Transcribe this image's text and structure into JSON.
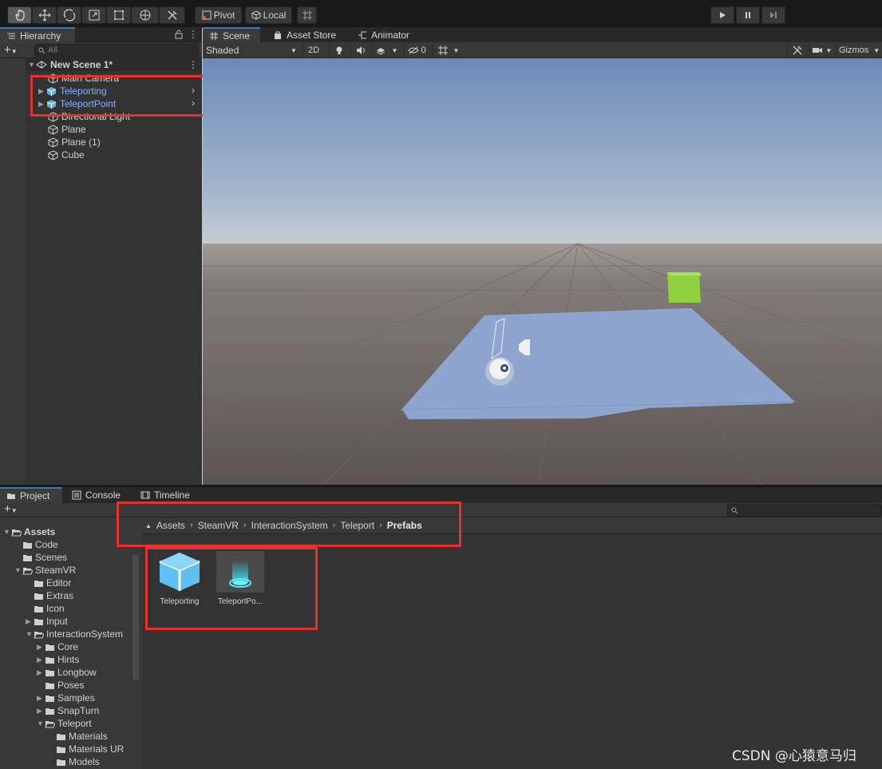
{
  "toolbar": {
    "pivot_label": "Pivot",
    "local_label": "Local"
  },
  "hierarchy": {
    "tab_label": "Hierarchy",
    "search_placeholder": "All",
    "scene_name": "New Scene 1*",
    "items": [
      {
        "label": "Main Camera",
        "prefab": false
      },
      {
        "label": "Teleporting",
        "prefab": true
      },
      {
        "label": "TeleportPoint",
        "prefab": true
      },
      {
        "label": "Directional Light",
        "prefab": false
      },
      {
        "label": "Plane",
        "prefab": false
      },
      {
        "label": "Plane (1)",
        "prefab": false
      },
      {
        "label": "Cube",
        "prefab": false
      }
    ]
  },
  "scene_tabs": {
    "scene": "Scene",
    "asset_store": "Asset Store",
    "animator": "Animator"
  },
  "scene_toolbar": {
    "shading_mode": "Shaded",
    "mode_2d": "2D",
    "hidden_count": "0",
    "gizmos": "Gizmos"
  },
  "bottom_tabs": {
    "project": "Project",
    "console": "Console",
    "timeline": "Timeline"
  },
  "breadcrumb": [
    "Assets",
    "SteamVR",
    "InteractionSystem",
    "Teleport",
    "Prefabs"
  ],
  "project_tree": [
    {
      "label": "Assets",
      "level": 0,
      "expanded": true,
      "bold": true
    },
    {
      "label": "Code",
      "level": 1
    },
    {
      "label": "Scenes",
      "level": 1
    },
    {
      "label": "SteamVR",
      "level": 1,
      "expanded": true
    },
    {
      "label": "Editor",
      "level": 2
    },
    {
      "label": "Extras",
      "level": 2
    },
    {
      "label": "Icon",
      "level": 2
    },
    {
      "label": "Input",
      "level": 2,
      "collapsed": true
    },
    {
      "label": "InteractionSystem",
      "level": 2,
      "expanded": true
    },
    {
      "label": "Core",
      "level": 3,
      "collapsed": true
    },
    {
      "label": "Hints",
      "level": 3,
      "collapsed": true
    },
    {
      "label": "Longbow",
      "level": 3,
      "collapsed": true
    },
    {
      "label": "Poses",
      "level": 3
    },
    {
      "label": "Samples",
      "level": 3,
      "collapsed": true
    },
    {
      "label": "SnapTurn",
      "level": 3,
      "collapsed": true
    },
    {
      "label": "Teleport",
      "level": 3,
      "expanded": true
    },
    {
      "label": "Materials",
      "level": 4
    },
    {
      "label": "Materials UR",
      "level": 4
    },
    {
      "label": "Models",
      "level": 4
    }
  ],
  "assets": [
    {
      "label": "Teleporting",
      "icon": "prefab-cube-icon"
    },
    {
      "label": "TeleportPo...",
      "icon": "teleport-point-icon"
    }
  ],
  "watermark": "CSDN @心猿意马归",
  "colors": {
    "highlight_box": "#e8302e",
    "prefab_text": "#7eb5ff",
    "cube_green": "#8fd13f",
    "plane_blue": "#8ea6cf"
  }
}
